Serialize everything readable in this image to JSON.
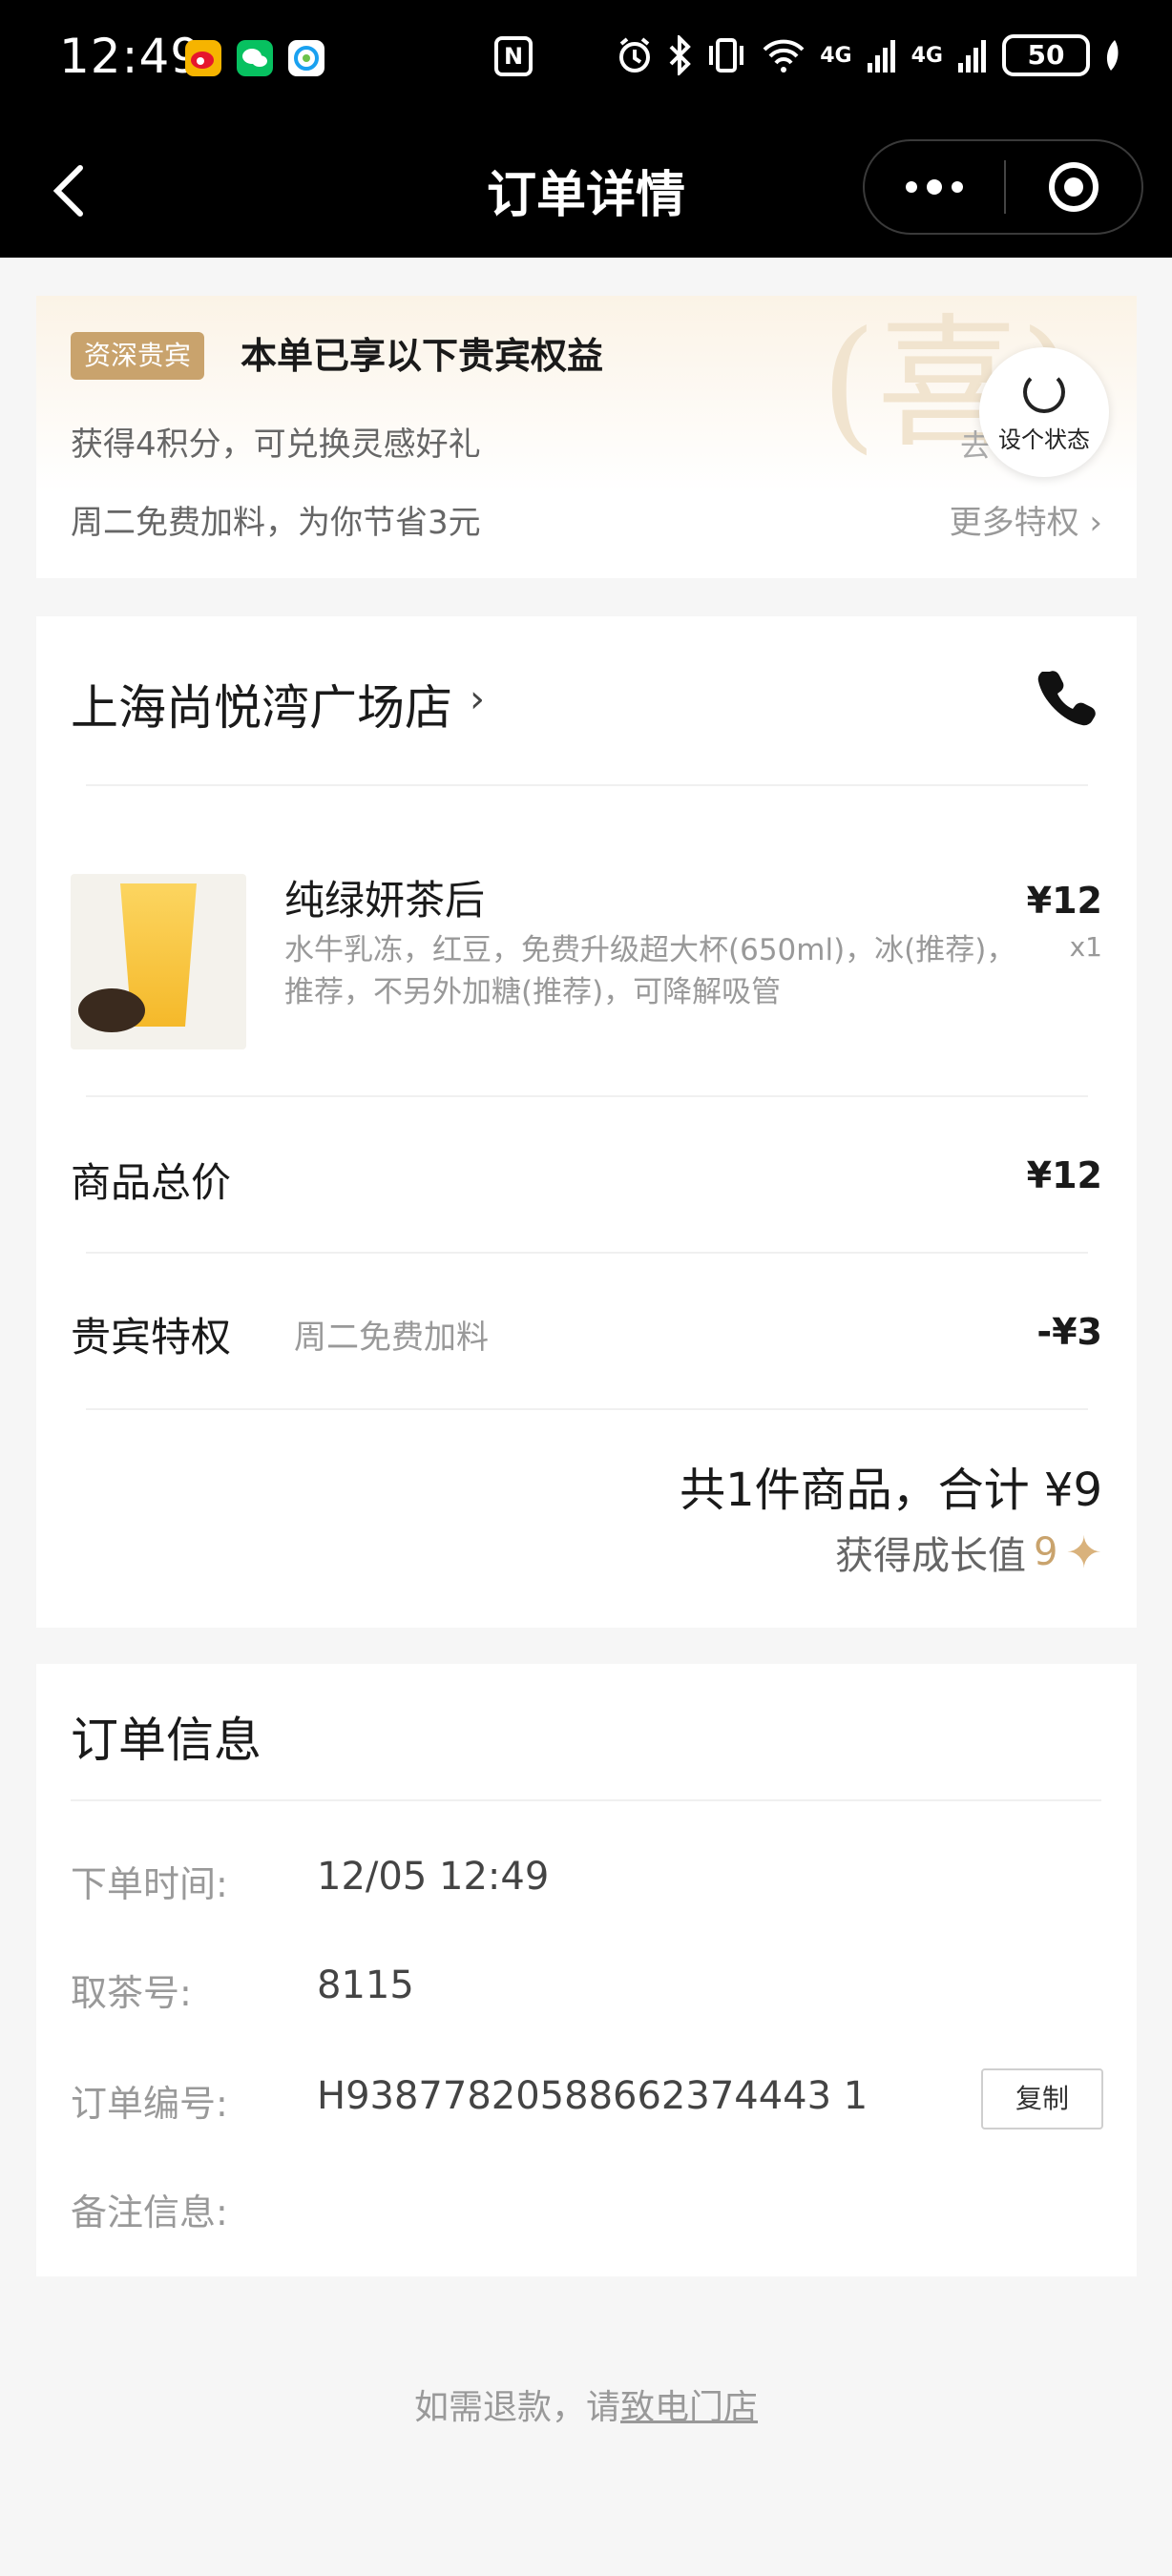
{
  "status_bar": {
    "time": "12:49",
    "nfc_label": "N",
    "signal_1": "4G",
    "signal_2": "4G",
    "battery": "50",
    "icons": [
      "weibo-icon",
      "wechat-icon",
      "photo-icon",
      "alarm-icon",
      "bluetooth-icon",
      "vibrate-icon",
      "wifi-icon",
      "signal-icon",
      "battery-icon",
      "leaf-icon"
    ]
  },
  "nav": {
    "title": "订单详情"
  },
  "privileges": {
    "tag": "资深贵宾",
    "title": "本单已享以下贵宾权益",
    "line1": "获得4积分，可兑换灵感好礼",
    "go_text": "去",
    "line2": "周二免费加料，为你节省3元",
    "more": "更多特权 ›",
    "watermark": "(喜)"
  },
  "float_status": {
    "label": "设个状态"
  },
  "order": {
    "store_name": "上海尚悦湾广场店",
    "store_arrow": "›",
    "product": {
      "name": "纯绿妍茶后",
      "desc": "水牛乳冻，红豆，免费升级超大杯(650ml)，冰(推荐)，推荐，不另外加糖(推荐)，可降解吸管",
      "price": "¥12",
      "qty": "x1"
    },
    "goods_total_label": "商品总价",
    "goods_total_value": "¥12",
    "vip_label": "贵宾特权",
    "vip_sub": "周二免费加料",
    "vip_value": "-¥3",
    "summary": "共1件商品，合计 ¥9",
    "growth_label": "获得成长值",
    "growth_value": "9"
  },
  "info": {
    "title": "订单信息",
    "order_time_label": "下单时间:",
    "order_time_value": "12/05 12:49",
    "pickup_label": "取茶号:",
    "pickup_value": "8115",
    "order_no_label": "订单编号:",
    "order_no_value": "H93877820588662374443 1",
    "copy_label": "复制",
    "remark_label": "备注信息:"
  },
  "footer": {
    "prefix": "如需退款，请",
    "link": "致电门店"
  },
  "colors": {
    "gold": "#c9a36d",
    "header_bg": "#000000",
    "page_bg": "#f6f6f6"
  }
}
